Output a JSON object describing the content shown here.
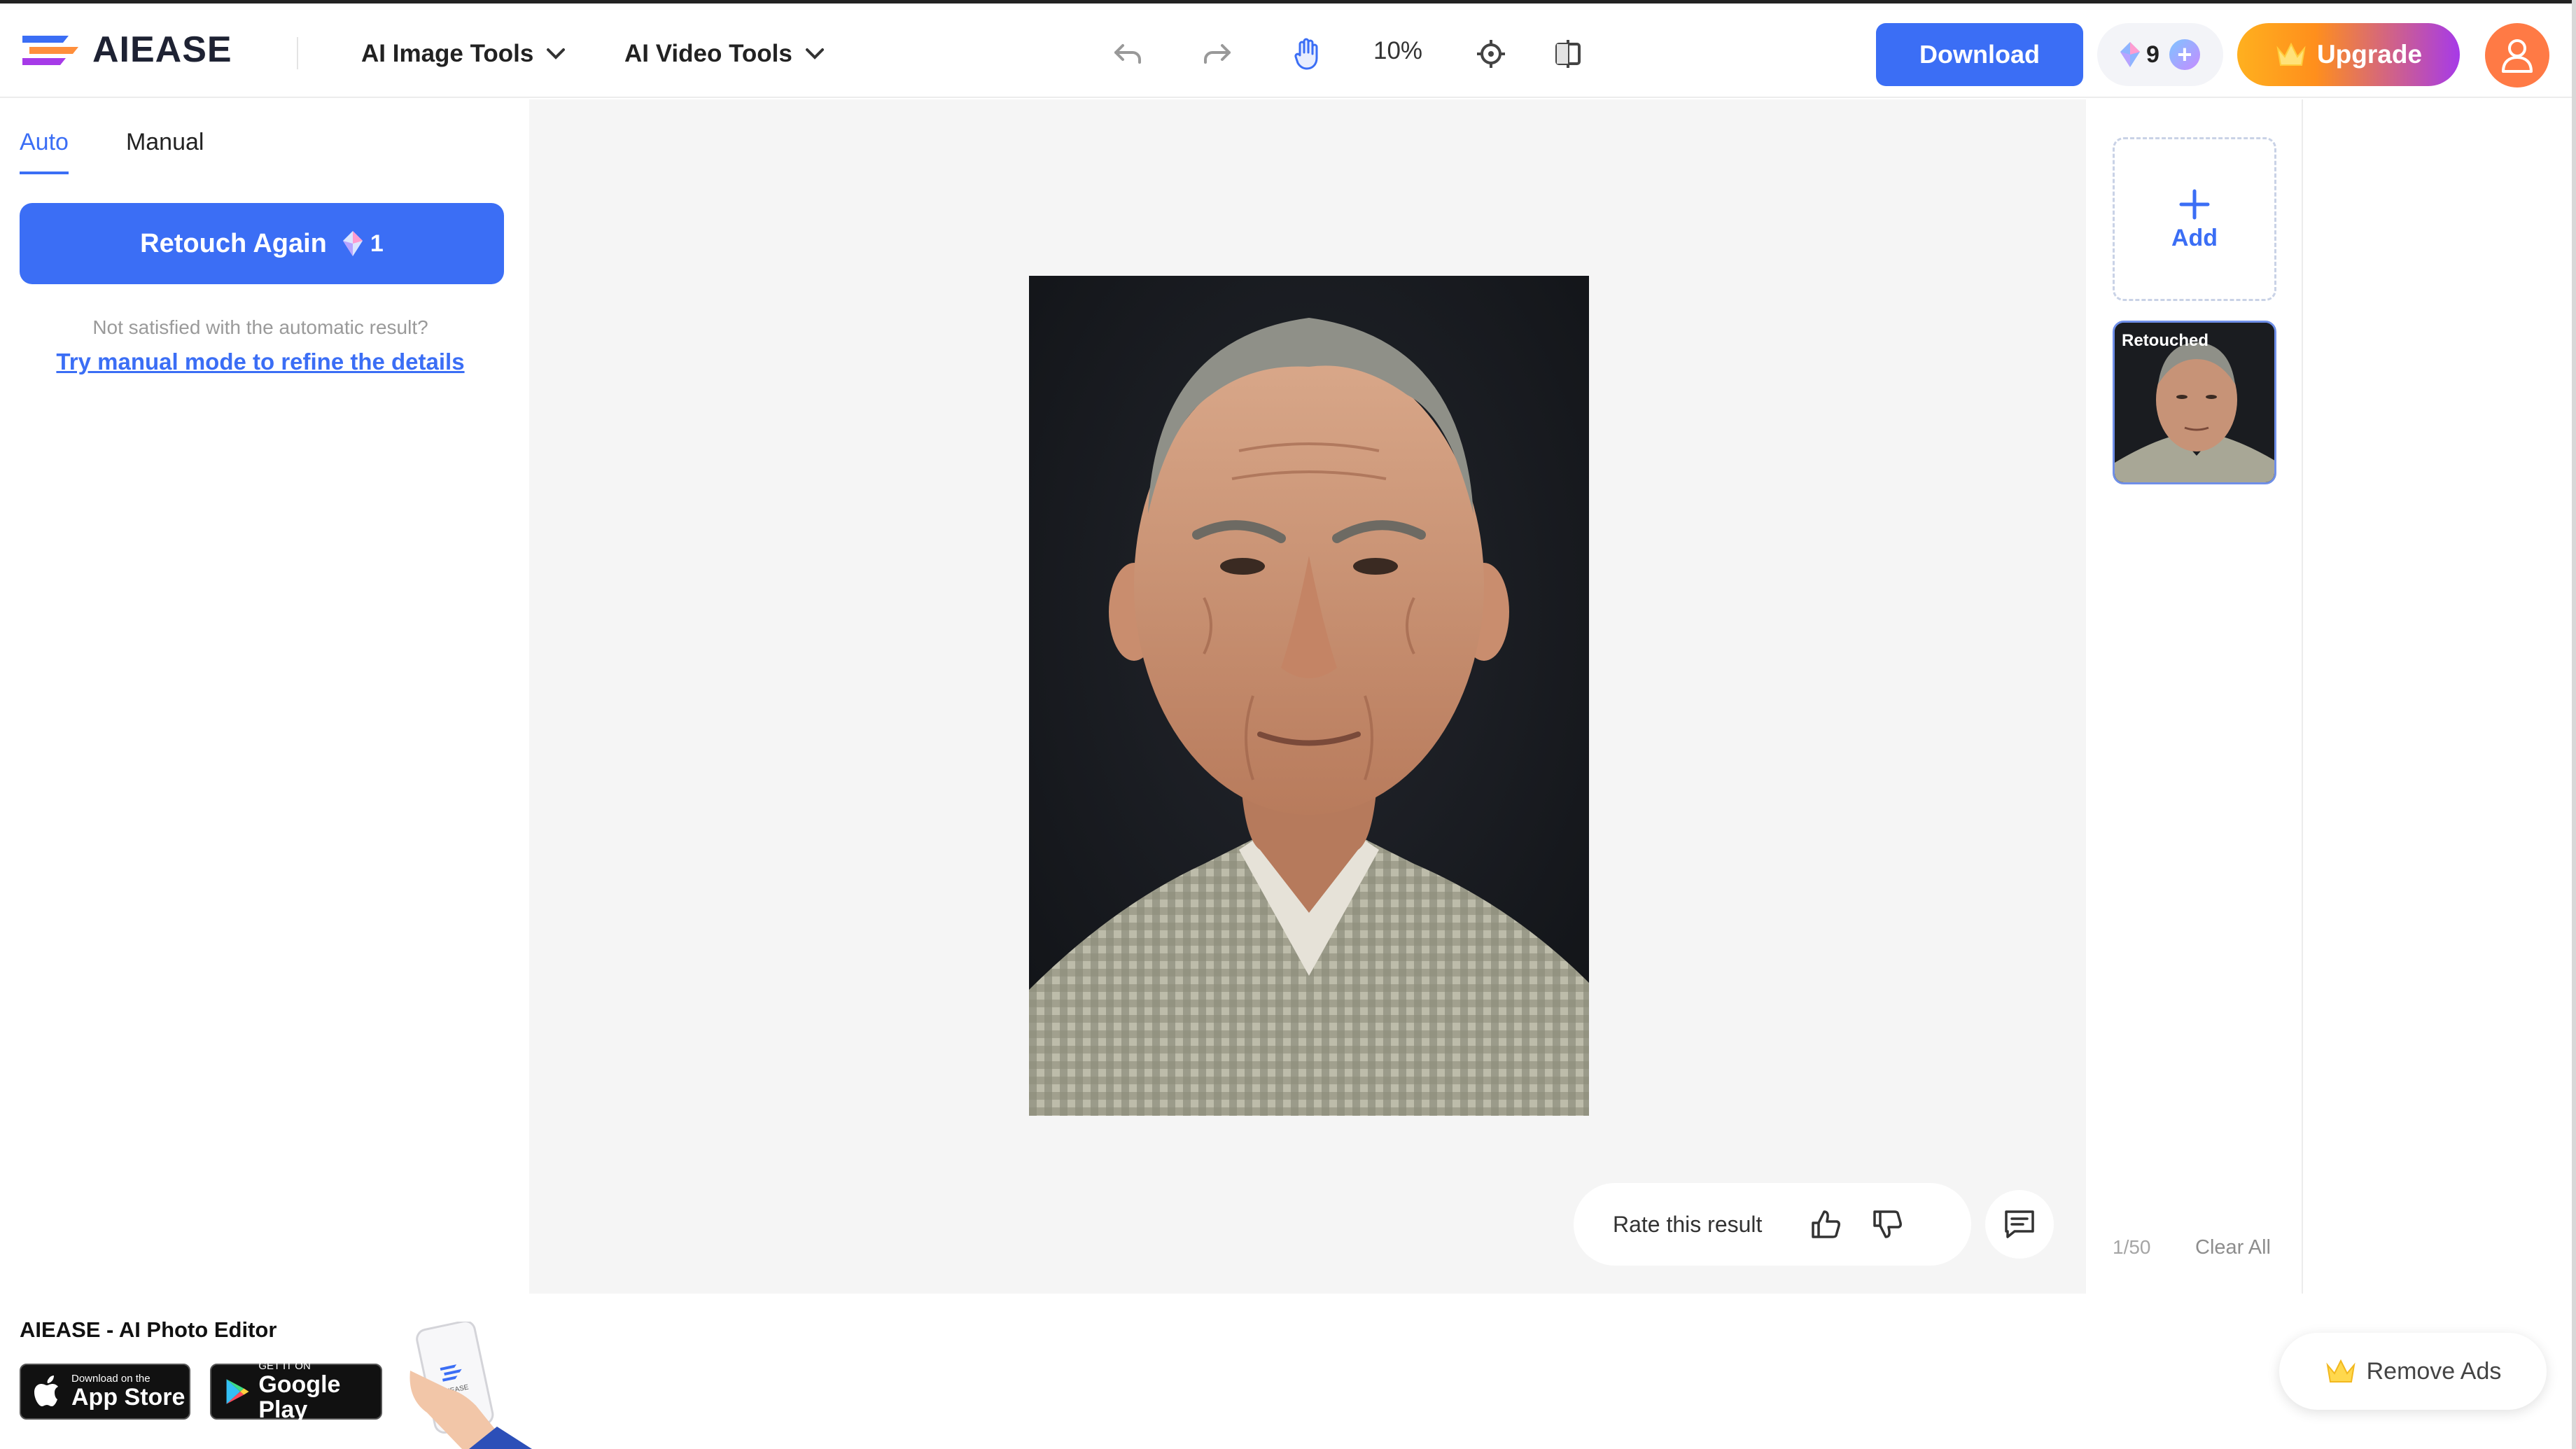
{
  "app": {
    "brand_name": "AIEASE"
  },
  "header": {
    "menus": [
      {
        "label": "AI Image Tools"
      },
      {
        "label": "AI Video Tools"
      }
    ],
    "zoom_level": "10%",
    "download_label": "Download",
    "credits_count": "9",
    "credits_plus": "+",
    "upgrade_label": "Upgrade"
  },
  "left_panel": {
    "tabs": [
      {
        "label": "Auto",
        "active": true
      },
      {
        "label": "Manual",
        "active": false
      }
    ],
    "retouch_label": "Retouch Again",
    "retouch_cost": "1",
    "hint_text": "Not satisfied with the automatic result?",
    "manual_link": "Try manual mode to refine the details"
  },
  "canvas": {
    "rate_label": "Rate this result"
  },
  "right_panel": {
    "add_label": "Add",
    "thumb_badge": "Retouched",
    "counter": "1/50",
    "clear_all": "Clear All"
  },
  "promo": {
    "title": "AIEASE - AI Photo Editor",
    "app_store_small": "Download on the",
    "app_store_big": "App Store",
    "google_small": "GET IT ON",
    "google_big": "Google Play",
    "phone_label": "AIEASE",
    "remove_ads": "Remove Ads"
  },
  "colors": {
    "accent": "#3b6ef5",
    "upgrade_start": "#ffb01f",
    "upgrade_end": "#a63ae8",
    "avatar": "#ff7a45"
  },
  "icons": {
    "undo": "undo-icon",
    "redo": "redo-icon",
    "hand": "hand-icon",
    "target": "crosshair-icon",
    "compare": "compare-icon",
    "crown": "crown-icon",
    "gem": "gem-icon"
  }
}
